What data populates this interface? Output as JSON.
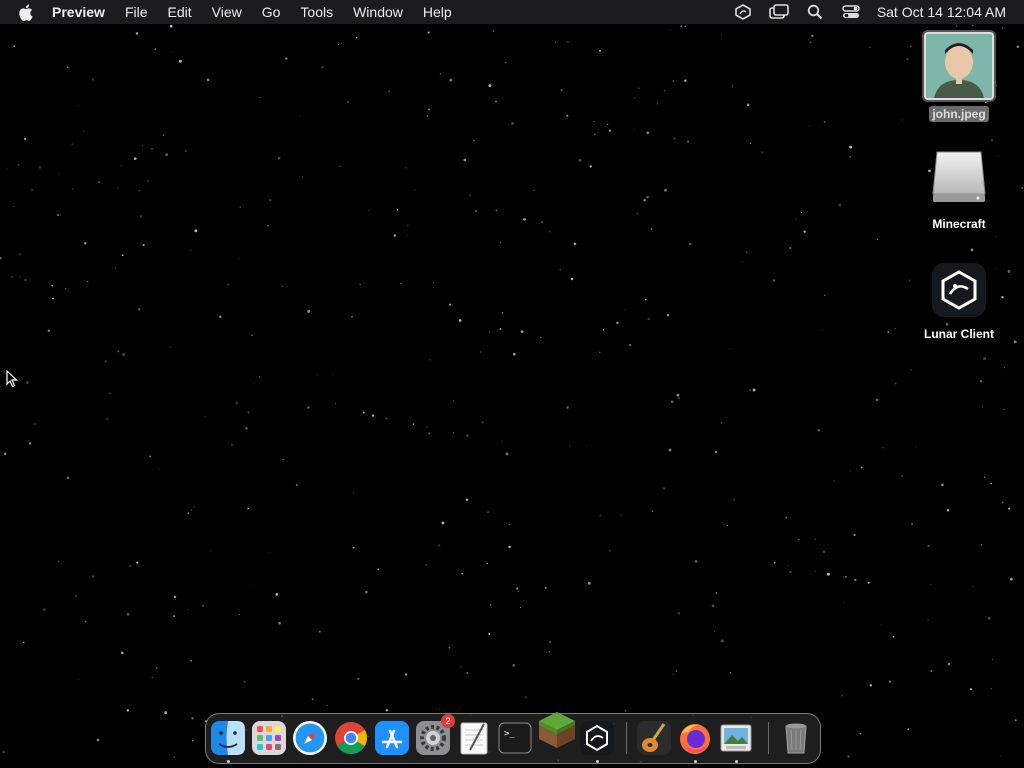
{
  "menubar": {
    "app_name": "Preview",
    "menus": [
      "File",
      "Edit",
      "View",
      "Go",
      "Tools",
      "Window",
      "Help"
    ],
    "status_icons": [
      "lunar-client-status-icon",
      "screen-mirroring-icon",
      "spotlight-search-icon",
      "control-center-icon"
    ],
    "clock": "Sat Oct 14  12:04 AM"
  },
  "desktop": {
    "icons": [
      {
        "label": "john.jpeg",
        "icon": "image-file-icon"
      },
      {
        "label": "Minecraft",
        "icon": "disk-drive-icon"
      },
      {
        "label": "Lunar Client",
        "icon": "lunar-client-icon"
      }
    ]
  },
  "dock": {
    "apps": [
      {
        "name": "Finder",
        "icon": "finder-icon",
        "running": true
      },
      {
        "name": "Launchpad",
        "icon": "launchpad-icon",
        "running": false
      },
      {
        "name": "Safari",
        "icon": "safari-icon",
        "running": false
      },
      {
        "name": "Google Chrome",
        "icon": "chrome-icon",
        "running": false
      },
      {
        "name": "App Store",
        "icon": "app-store-icon",
        "running": false
      },
      {
        "name": "System Settings",
        "icon": "system-settings-icon",
        "running": false,
        "badge": "2"
      },
      {
        "name": "TextEdit",
        "icon": "textedit-icon",
        "running": false
      },
      {
        "name": "Terminal",
        "icon": "terminal-icon",
        "running": false
      },
      {
        "name": "Minecraft",
        "icon": "minecraft-icon",
        "running": false
      },
      {
        "name": "Lunar Client",
        "icon": "lunar-client-icon",
        "running": true
      },
      {
        "name": "GarageBand",
        "icon": "garageband-icon",
        "running": false
      },
      {
        "name": "Firefox",
        "icon": "firefox-icon",
        "running": true
      },
      {
        "name": "Preview",
        "icon": "preview-icon",
        "running": true
      },
      {
        "name": "Trash",
        "icon": "trash-icon",
        "running": false
      }
    ],
    "terminal_prompt": ">_"
  },
  "colors": {
    "menubar_bg": "#1c1c1e",
    "desktop_bg": "#000000",
    "badge": "#e53935"
  }
}
